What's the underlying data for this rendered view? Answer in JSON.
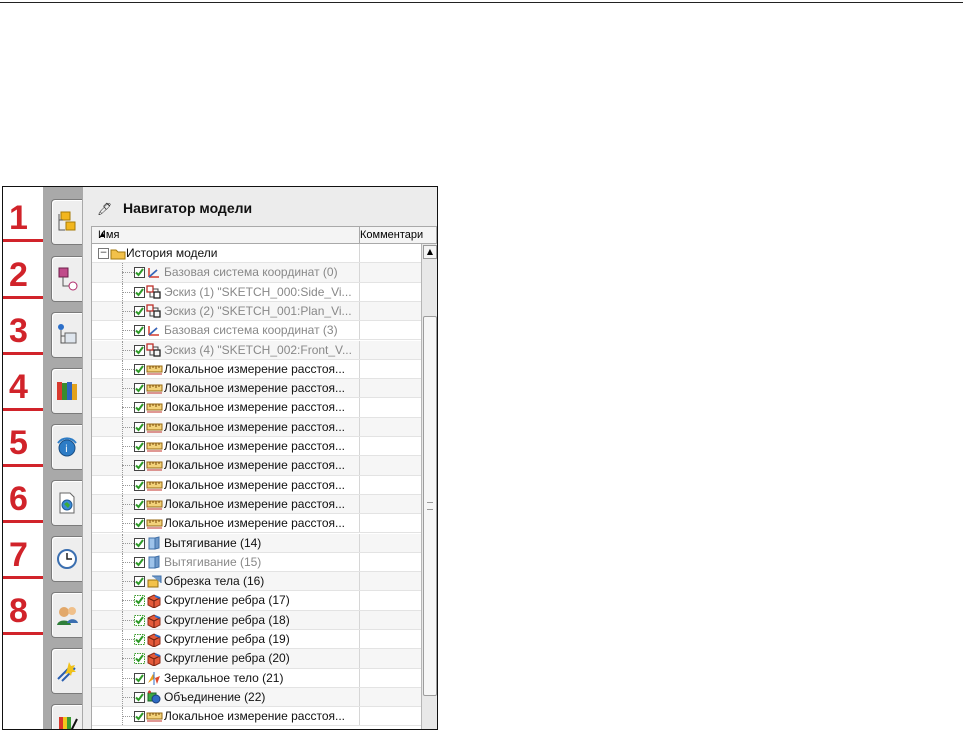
{
  "navigator": {
    "title": "Навигатор модели",
    "pin_icon": "pin-icon",
    "columns": {
      "name": "Имя",
      "comment": "Комментари"
    }
  },
  "callouts": [
    "1",
    "2",
    "3",
    "4",
    "5",
    "6",
    "7",
    "8"
  ],
  "tabs": [
    {
      "icon": "assembly-navigator-icon"
    },
    {
      "icon": "constraint-navigator-icon"
    },
    {
      "icon": "part-navigator-icon"
    },
    {
      "icon": "reuse-library-icon"
    },
    {
      "icon": "hd3d-tools-icon"
    },
    {
      "icon": "web-browser-icon"
    },
    {
      "icon": "history-icon"
    },
    {
      "icon": "system-materials-icon"
    },
    {
      "icon": "process-studio-icon"
    },
    {
      "icon": "roles-icon"
    }
  ],
  "tree": {
    "root": "История модели",
    "items": [
      {
        "label": "Базовая система координат (0)",
        "icon": "datum-csys-icon",
        "dim": true
      },
      {
        "label": "Эскиз (1) \"SKETCH_000:Side_Vi...",
        "icon": "sketch-icon",
        "dim": true
      },
      {
        "label": "Эскиз (2) \"SKETCH_001:Plan_Vi...",
        "icon": "sketch-icon",
        "dim": true
      },
      {
        "label": "Базовая система координат (3)",
        "icon": "datum-csys-icon",
        "dim": true
      },
      {
        "label": "Эскиз (4) \"SKETCH_002:Front_V...",
        "icon": "sketch-icon",
        "dim": true
      },
      {
        "label": "Локальное измерение расстоя...",
        "icon": "measure-distance-icon",
        "dim": false
      },
      {
        "label": "Локальное измерение расстоя...",
        "icon": "measure-distance-icon",
        "dim": false
      },
      {
        "label": "Локальное измерение расстоя...",
        "icon": "measure-distance-icon",
        "dim": false
      },
      {
        "label": "Локальное измерение расстоя...",
        "icon": "measure-distance-icon",
        "dim": false
      },
      {
        "label": "Локальное измерение расстоя...",
        "icon": "measure-distance-icon",
        "dim": false
      },
      {
        "label": "Локальное измерение расстоя...",
        "icon": "measure-distance-icon",
        "dim": false
      },
      {
        "label": "Локальное измерение расстоя...",
        "icon": "measure-distance-icon",
        "dim": false
      },
      {
        "label": "Локальное измерение расстоя...",
        "icon": "measure-distance-icon",
        "dim": false
      },
      {
        "label": "Локальное измерение расстоя...",
        "icon": "measure-distance-icon",
        "dim": false
      },
      {
        "label": "Вытягивание (14)",
        "icon": "extrude-icon",
        "dim": false
      },
      {
        "label": "Вытягивание (15)",
        "icon": "extrude-icon",
        "dim": true
      },
      {
        "label": "Обрезка тела (16)",
        "icon": "trim-body-icon",
        "dim": false
      },
      {
        "label": "Скругление ребра (17)",
        "icon": "edge-blend-icon",
        "dim": false
      },
      {
        "label": "Скругление ребра (18)",
        "icon": "edge-blend-icon",
        "dim": false
      },
      {
        "label": "Скругление ребра (19)",
        "icon": "edge-blend-icon",
        "dim": false
      },
      {
        "label": "Скругление ребра (20)",
        "icon": "edge-blend-icon",
        "dim": false
      },
      {
        "label": "Зеркальное тело (21)",
        "icon": "mirror-body-icon",
        "dim": false
      },
      {
        "label": "Объединение (22)",
        "icon": "unite-icon",
        "dim": false
      },
      {
        "label": "Локальное измерение расстоя...",
        "icon": "measure-distance-icon",
        "dim": false
      }
    ]
  },
  "colors": {
    "callout": "#d1232a",
    "check": "#3a9a2a",
    "tabstrip": "#a9a9a9"
  }
}
